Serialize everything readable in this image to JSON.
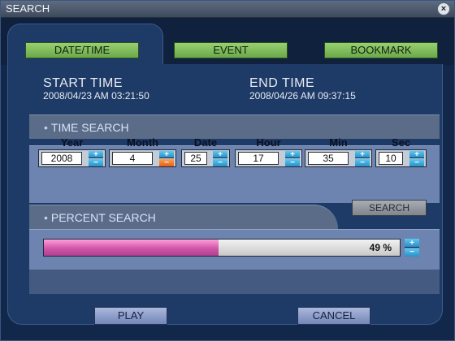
{
  "window": {
    "title": "SEARCH",
    "close_glyph": "×"
  },
  "tabs": [
    {
      "label": "DATE/TIME",
      "active": true
    },
    {
      "label": "EVENT",
      "active": false
    },
    {
      "label": "BOOKMARK",
      "active": false
    }
  ],
  "start": {
    "heading": "START TIME",
    "value": "2008/04/23 AM 03:21:50"
  },
  "end": {
    "heading": "END TIME",
    "value": "2008/04/26 AM 09:37:15"
  },
  "time_search": {
    "header": "TIME SEARCH",
    "fields": [
      {
        "label": "Year",
        "value": "2008"
      },
      {
        "label": "Month",
        "value": "4"
      },
      {
        "label": "Date",
        "value": "25"
      },
      {
        "label": "Hour",
        "value": "17"
      },
      {
        "label": "Min",
        "value": "35"
      },
      {
        "label": "Sec",
        "value": "10"
      }
    ],
    "search_label": "SEARCH"
  },
  "percent_search": {
    "header": "PERCENT SEARCH",
    "percent": 49,
    "percent_text": "49 %"
  },
  "buttons": {
    "play": "PLAY",
    "cancel": "CANCEL"
  },
  "colors": {
    "tab_green": "#7ab85a",
    "progress_pink": "#d055a8",
    "spin_blue": "#2a8fc8",
    "spin_active": "#e0601a"
  }
}
